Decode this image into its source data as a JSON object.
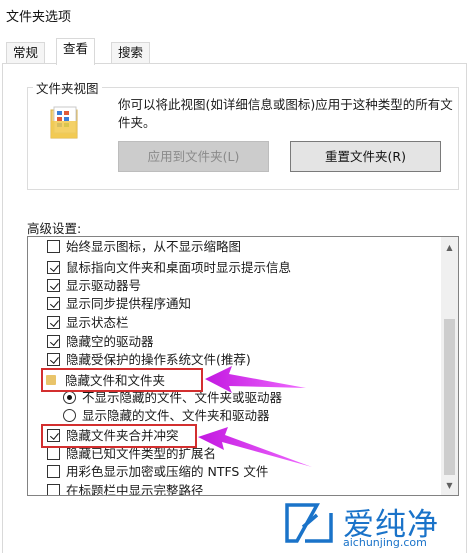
{
  "window": {
    "title": "文件夹选项"
  },
  "tabs": [
    {
      "label": "常规",
      "active": false
    },
    {
      "label": "查看",
      "active": true
    },
    {
      "label": "搜索",
      "active": false
    }
  ],
  "folder_views": {
    "legend": "文件夹视图",
    "description": "你可以将此视图(如详细信息或图标)应用于这种类型的所有文件夹。",
    "apply_button": "应用到文件夹(L)",
    "reset_button": "重置文件夹(R)"
  },
  "advanced": {
    "label": "高级设置:",
    "items": [
      {
        "type": "checkbox",
        "checked": false,
        "label": "始终显示图标，从不显示缩略图"
      },
      {
        "type": "checkbox",
        "checked": true,
        "label": "鼠标指向文件夹和桌面项时显示提示信息"
      },
      {
        "type": "checkbox",
        "checked": true,
        "label": "显示驱动器号"
      },
      {
        "type": "checkbox",
        "checked": true,
        "label": "显示同步提供程序通知"
      },
      {
        "type": "checkbox",
        "checked": true,
        "label": "显示状态栏"
      },
      {
        "type": "checkbox",
        "checked": true,
        "label": "隐藏空的驱动器"
      },
      {
        "type": "checkbox",
        "checked": true,
        "label": "隐藏受保护的操作系统文件(推荐)"
      },
      {
        "type": "folder",
        "label": "隐藏文件和文件夹"
      },
      {
        "type": "radio",
        "checked": true,
        "label": "不显示隐藏的文件、文件夹或驱动器"
      },
      {
        "type": "radio",
        "checked": false,
        "label": "显示隐藏的文件、文件夹和驱动器"
      },
      {
        "type": "checkbox",
        "checked": true,
        "label": "隐藏文件夹合并冲突"
      },
      {
        "type": "checkbox",
        "checked": false,
        "label": "隐藏已知文件类型的扩展名"
      },
      {
        "type": "checkbox",
        "checked": false,
        "label": "用彩色显示加密或压缩的 NTFS 文件"
      },
      {
        "type": "checkbox",
        "checked": false,
        "label": "在标题栏中显示完整路径"
      }
    ]
  },
  "watermark": {
    "text": "爱纯净",
    "url": "aichunjing.com",
    "color": "#1a73c9"
  },
  "annotation": {
    "highlight_color": "#d32f2f",
    "arrow_color": "#e040fb"
  }
}
